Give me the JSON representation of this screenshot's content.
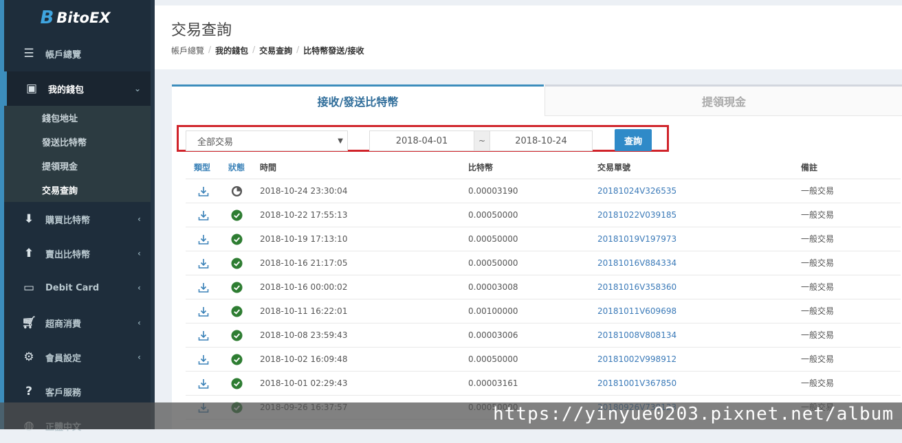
{
  "app": {
    "logo_text": "BitoEX"
  },
  "sidebar": {
    "items": [
      {
        "label": "帳戶總覽",
        "icon": "server-icon"
      },
      {
        "label": "我的錢包",
        "icon": "money-icon",
        "active": true,
        "subitems": [
          "錢包地址",
          "發送比特幣",
          "提領現金",
          "交易查詢"
        ]
      },
      {
        "label": "購買比特幣",
        "icon": "arrow-circle-down-icon"
      },
      {
        "label": "賣出比特幣",
        "icon": "arrow-circle-up-icon"
      },
      {
        "label": "Debit Card",
        "icon": "credit-card-icon"
      },
      {
        "label": "超商消費",
        "icon": "cart-icon"
      },
      {
        "label": "會員設定",
        "icon": "gears-icon"
      },
      {
        "label": "客戶服務",
        "icon": "question-circle-icon"
      },
      {
        "label": "正體中文",
        "icon": "globe-icon"
      }
    ]
  },
  "page": {
    "title": "交易查詢",
    "breadcrumb": [
      "帳戶總覽",
      "我的錢包",
      "交易查詢",
      "比特幣發送/接收"
    ]
  },
  "tabs": {
    "active": "接收/發送比特幣",
    "inactive": "提領現金"
  },
  "filter": {
    "type_selected": "全部交易",
    "date_from": "2018-04-01",
    "date_to": "2018-10-24",
    "tilde": "~",
    "query_button": "查詢"
  },
  "table": {
    "headers": {
      "type": "類型",
      "status": "狀態",
      "time": "時間",
      "amount": "比特幣",
      "txid": "交易單號",
      "note": "備註"
    },
    "rows": [
      {
        "time": "2018-10-24 23:30:04",
        "amount": "0.00003190",
        "txid": "20181024V326535",
        "note": "一般交易",
        "status": "pending"
      },
      {
        "time": "2018-10-22 17:55:13",
        "amount": "0.00050000",
        "txid": "20181022V039185",
        "note": "一般交易",
        "status": "done"
      },
      {
        "time": "2018-10-19 17:13:10",
        "amount": "0.00050000",
        "txid": "20181019V197973",
        "note": "一般交易",
        "status": "done"
      },
      {
        "time": "2018-10-16 21:17:05",
        "amount": "0.00050000",
        "txid": "20181016V884334",
        "note": "一般交易",
        "status": "done"
      },
      {
        "time": "2018-10-16 00:00:02",
        "amount": "0.00003008",
        "txid": "20181016V358360",
        "note": "一般交易",
        "status": "done"
      },
      {
        "time": "2018-10-11 16:22:01",
        "amount": "0.00100000",
        "txid": "20181011V609698",
        "note": "一般交易",
        "status": "done"
      },
      {
        "time": "2018-10-08 23:59:43",
        "amount": "0.00003006",
        "txid": "20181008V808134",
        "note": "一般交易",
        "status": "done"
      },
      {
        "time": "2018-10-02 16:09:48",
        "amount": "0.00050000",
        "txid": "20181002V998912",
        "note": "一般交易",
        "status": "done"
      },
      {
        "time": "2018-10-01 02:29:43",
        "amount": "0.00003161",
        "txid": "20181001V367850",
        "note": "一般交易",
        "status": "done"
      },
      {
        "time": "2018-09-26 16:37:57",
        "amount": "0.00050000",
        "txid": "20180926V738123",
        "note": "一般交易",
        "status": "done"
      }
    ]
  },
  "watermark": "https://yinyue0203.pixnet.net/album",
  "colors": {
    "sidebar": "#1e2d3b",
    "accent": "#3c8dbc",
    "success": "#2e7d32",
    "highlight_box": "#d0232a"
  }
}
